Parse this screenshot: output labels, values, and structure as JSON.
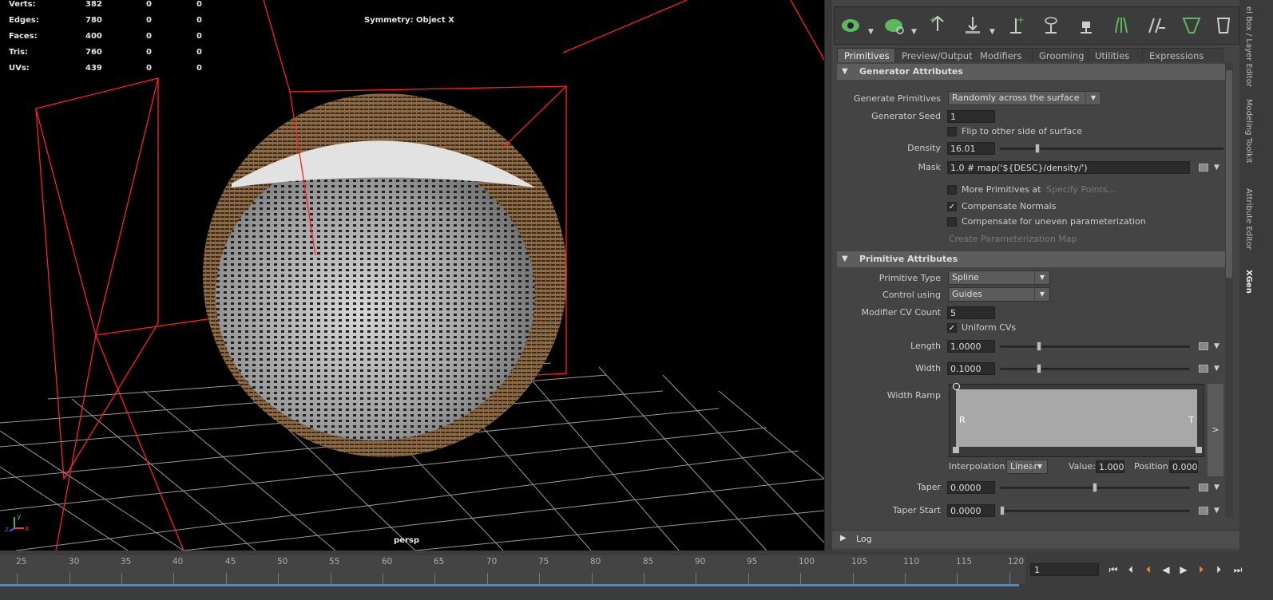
{
  "viewport": {
    "stats": [
      {
        "label": "Verts:",
        "v1": "382",
        "v2": "0",
        "v3": "0"
      },
      {
        "label": "Edges:",
        "v1": "780",
        "v2": "0",
        "v3": "0"
      },
      {
        "label": "Faces:",
        "v1": "400",
        "v2": "0",
        "v3": "0"
      },
      {
        "label": "Tris:",
        "v1": "760",
        "v2": "0",
        "v3": "0"
      },
      {
        "label": "UVs:",
        "v1": "439",
        "v2": "0",
        "v3": "0"
      }
    ],
    "symmetry": "Symmetry: Object X",
    "camera": "persp",
    "axis_labels": {
      "y": "y",
      "x": "x",
      "z": "z"
    }
  },
  "tabs": [
    "Primitives",
    "Preview/Output",
    "Modifiers",
    "Grooming",
    "Utilities",
    "Expressions"
  ],
  "generator": {
    "title": "Generator Attributes",
    "generate_label": "Generate Primitives",
    "generate_value": "Randomly across the surface",
    "seed_label": "Generator Seed",
    "seed_value": "1",
    "flip_label": "Flip to other side of surface",
    "density_label": "Density",
    "density_value": "16.01",
    "mask_label": "Mask",
    "mask_value": "1.0 # map('${DESC}/density/')",
    "more_label": "More Primitives at",
    "specify_label": "Specify Points...",
    "comp_normals_label": "Compensate Normals",
    "comp_uneven_label": "Compensate for uneven parameterization",
    "create_param_label": "Create Parameterization Map"
  },
  "primitive": {
    "title": "Primitive Attributes",
    "type_label": "Primitive Type",
    "type_value": "Spline",
    "control_label": "Control using",
    "control_value": "Guides",
    "cv_label": "Modifier CV Count",
    "cv_value": "5",
    "uniform_label": "Uniform CVs",
    "length_label": "Length",
    "length_value": "1.0000",
    "width_label": "Width",
    "width_value": "0.1000",
    "ramp_label": "Width Ramp",
    "ramp_r": "R",
    "ramp_t": "T",
    "ramp_expand": ">",
    "interp_label": "Interpolation:",
    "interp_value": "Linear",
    "value_label": "Value:",
    "value_value": "1.000",
    "position_label": "Position:",
    "position_value": "0.000",
    "taper_label": "Taper",
    "taper_value": "0.0000",
    "taper_start_label": "Taper Start",
    "taper_start_value": "0.0000"
  },
  "log": "Log",
  "side_tabs": [
    "el Box / Layer Editor",
    "Modeling Toolkit",
    "Attribute Editor",
    "XGen"
  ],
  "timeline": {
    "ticks": [
      "25",
      "30",
      "35",
      "40",
      "45",
      "50",
      "55",
      "60",
      "65",
      "70",
      "75",
      "80",
      "85",
      "90",
      "95",
      "100",
      "105",
      "110",
      "115",
      "120"
    ],
    "current_frame": "1"
  },
  "colors": {
    "accent": "#5c87b0",
    "wire": "#ff2020",
    "hair": "#a07850"
  }
}
